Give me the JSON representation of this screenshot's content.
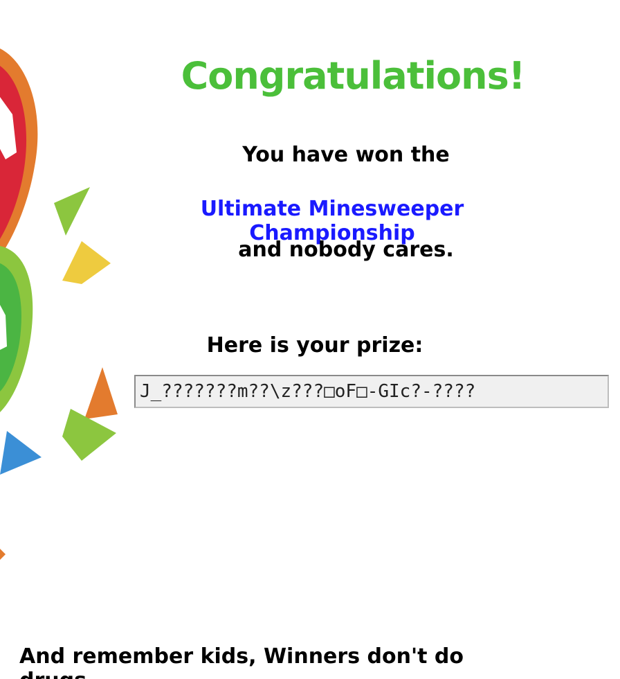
{
  "certificate": {
    "title": "Congratulations!",
    "won_line": "You have won the",
    "championship": "Ultimate Minesweeper Championship",
    "nobody_line": "and nobody cares.",
    "prize_label": "Here is your prize:",
    "prize_value": "J_???????m??\\z???□oF□-GIc?-????",
    "footer": "And remember kids, Winners don't do drugs"
  },
  "colors": {
    "title": "#4bbf3a",
    "championship": "#1a1aff",
    "text": "#000000",
    "balloon_red": "#d92638",
    "balloon_orange": "#e37b2e",
    "balloon_green": "#4bb543",
    "confetti_yellow": "#eecb3f",
    "confetti_green": "#8cc63f",
    "confetti_blue": "#3b8fd6"
  }
}
